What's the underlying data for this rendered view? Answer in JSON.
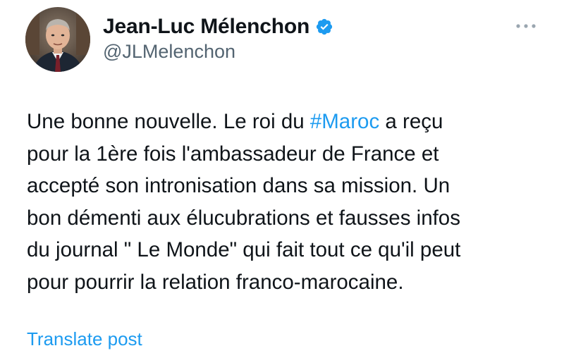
{
  "author": {
    "display_name": "Jean-Luc Mélenchon",
    "handle": "@JLMelenchon",
    "verified": true,
    "avatar_icon": "profile-photo"
  },
  "menu": {
    "icon": "more-horizontal-icon"
  },
  "post": {
    "lines": [
      {
        "before": "Une bonne nouvelle. Le roi du ",
        "hashtag": "#Maroc",
        "after": " a reçu"
      },
      {
        "before": "pour la 1ère fois l'ambassadeur de France et"
      },
      {
        "before": "accepté son intronisation dans sa mission. Un"
      },
      {
        "before": "bon démenti aux élucubrations et fausses infos"
      },
      {
        "before": "du journal \" Le Monde\" qui fait tout ce qu'il peut"
      },
      {
        "before": "pour pourrir la relation franco-marocaine."
      }
    ]
  },
  "actions": {
    "translate_label": "Translate post"
  },
  "colors": {
    "link": "#1d9bf0",
    "text": "#0f1419",
    "secondary": "#536471"
  }
}
